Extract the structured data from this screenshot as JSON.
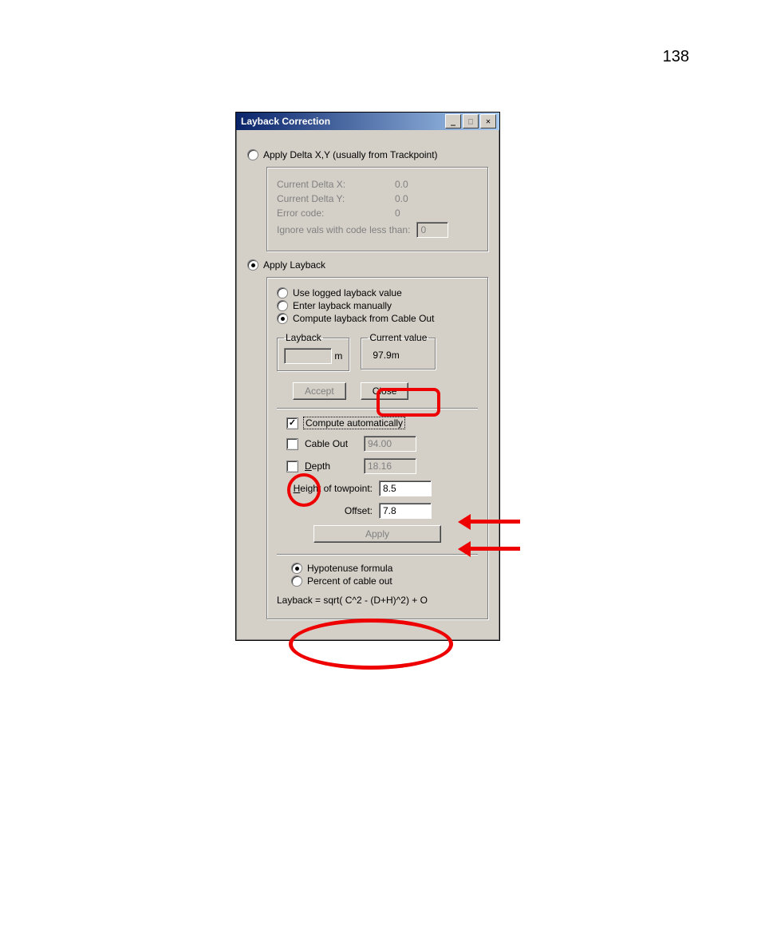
{
  "page": {
    "number": "138"
  },
  "window": {
    "title": "Layback Correction",
    "radio_delta_label": "Apply Delta X,Y (usually from Trackpoint)",
    "delta": {
      "dx_label": "Current Delta X:",
      "dx_value": "0.0",
      "dy_label": "Current Delta Y:",
      "dy_value": "0.0",
      "err_label": "Error code:",
      "err_value": "0",
      "ignore_label": "Ignore vals with code less than:",
      "ignore_value": "0"
    },
    "radio_layback_label": "Apply Layback",
    "layback": {
      "opt_logged": "Use logged layback value",
      "opt_manual": "Enter layback manually",
      "opt_compute": "Compute layback from Cable Out",
      "group_layback_legend": "Layback",
      "layback_value": "",
      "layback_unit": "m",
      "group_current_legend": "Current value",
      "current_value": "97.9m",
      "accept_btn": "Accept",
      "close_btn": "Close",
      "compute_auto_label": "Compute automatically",
      "cable_out_label": "Cable Out",
      "cable_out_value": "94.00",
      "depth_label_pre": "D",
      "depth_label_rest": "epth",
      "depth_value": "18.16",
      "height_label_pre": "H",
      "height_label_rest": "eight of towpoint:",
      "height_value": "8.5",
      "offset_label": "Offset:",
      "offset_value": "7.8",
      "apply_btn": "Apply",
      "formula_hyp": "Hypotenuse formula",
      "formula_pct": "Percent of cable out",
      "formula_text": "Layback = sqrt( C^2 - (D+H)^2) + O"
    }
  }
}
